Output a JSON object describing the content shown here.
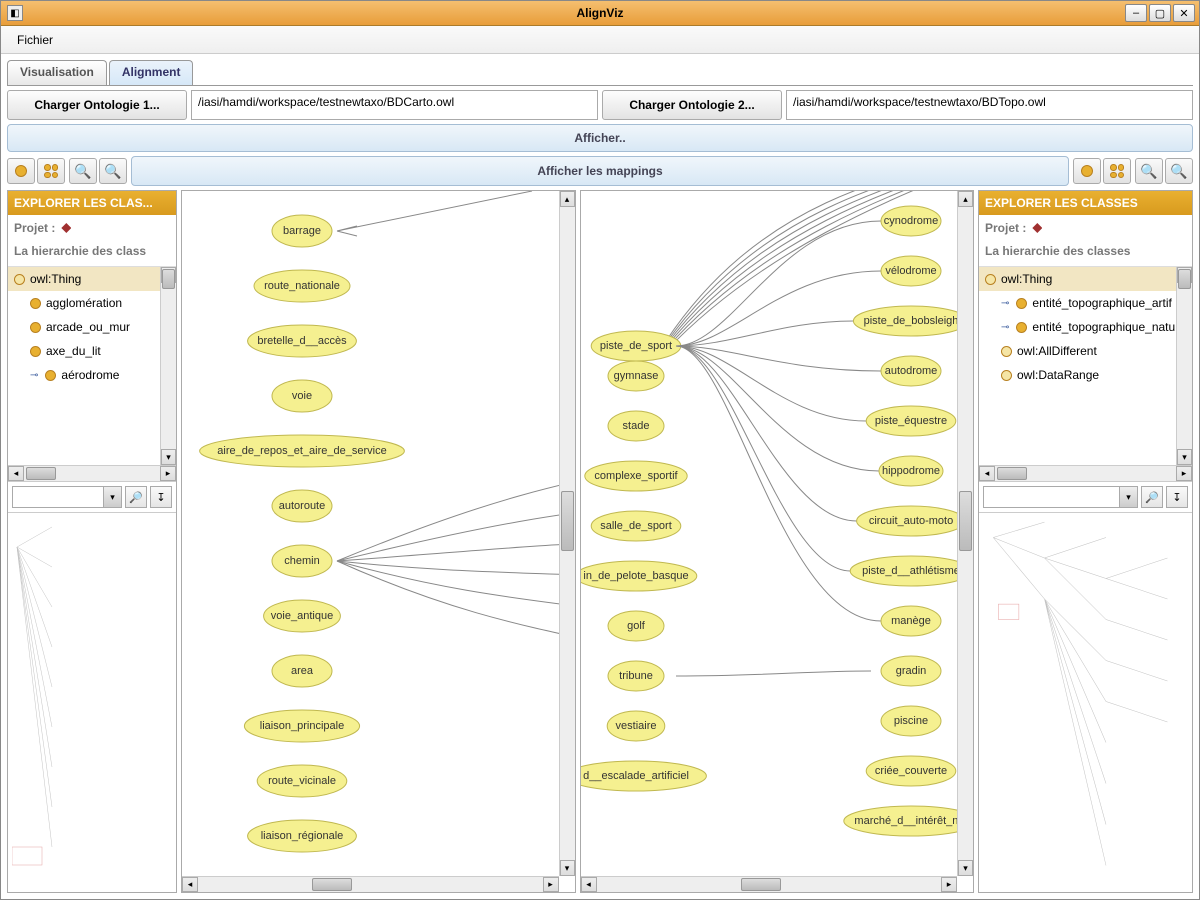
{
  "window": {
    "title": "AlignViz"
  },
  "menubar": {
    "file": "Fichier"
  },
  "tabs": {
    "visualisation": "Visualisation",
    "alignment": "Alignment"
  },
  "loaders": {
    "btn1": "Charger Ontologie 1...",
    "path1": "/iasi/hamdi/workspace/testnewtaxo/BDCarto.owl",
    "btn2": "Charger Ontologie 2...",
    "path2": "/iasi/hamdi/workspace/testnewtaxo/BDTopo.owl"
  },
  "bars": {
    "afficher": "Afficher..",
    "mappings": "Afficher les mappings"
  },
  "explorer_left": {
    "title": "EXPLORER LES CLAS...",
    "projet": "Projet :",
    "hierarchie": "La hierarchie des class",
    "items": [
      {
        "label": "owl:Thing",
        "root": true
      },
      {
        "label": "agglomération"
      },
      {
        "label": "arcade_ou_mur"
      },
      {
        "label": "axe_du_lit"
      },
      {
        "label": "aérodrome",
        "expandable": true
      }
    ]
  },
  "explorer_right": {
    "title": "EXPLORER LES CLASSES",
    "projet": "Projet :",
    "hierarchie": "La hierarchie des classes",
    "items": [
      {
        "label": "owl:Thing",
        "root": true
      },
      {
        "label": "entité_topographique_artif",
        "expandable": true
      },
      {
        "label": "entité_topographique_natu",
        "expandable": true
      },
      {
        "label": "owl:AllDifferent",
        "light": true
      },
      {
        "label": "owl:DataRange",
        "light": true
      }
    ]
  },
  "left_nodes": [
    "barrage",
    "route_nationale",
    "bretelle_d__accès",
    "voie",
    "aire_de_repos_et_aire_de_service",
    "autoroute",
    "chemin",
    "voie_antique",
    "area",
    "liaison_principale",
    "route_vicinale",
    "liaison_régionale"
  ],
  "mid_nodes": [
    "piste_de_sport",
    "gymnase",
    "stade",
    "complexe_sportif",
    "salle_de_sport",
    "in_de_pelote_basque",
    "golf",
    "tribune",
    "vestiaire",
    "d__escalade_artificiel"
  ],
  "right_nodes": [
    "cynodrome",
    "vélodrome",
    "piste_de_bobsleigh",
    "autodrome",
    "piste_équestre",
    "hippodrome",
    "circuit_auto-moto",
    "piste_d__athlétisme",
    "manège",
    "gradin",
    "piscine",
    "criée_couverte",
    "marché_d__intérêt_nat"
  ]
}
